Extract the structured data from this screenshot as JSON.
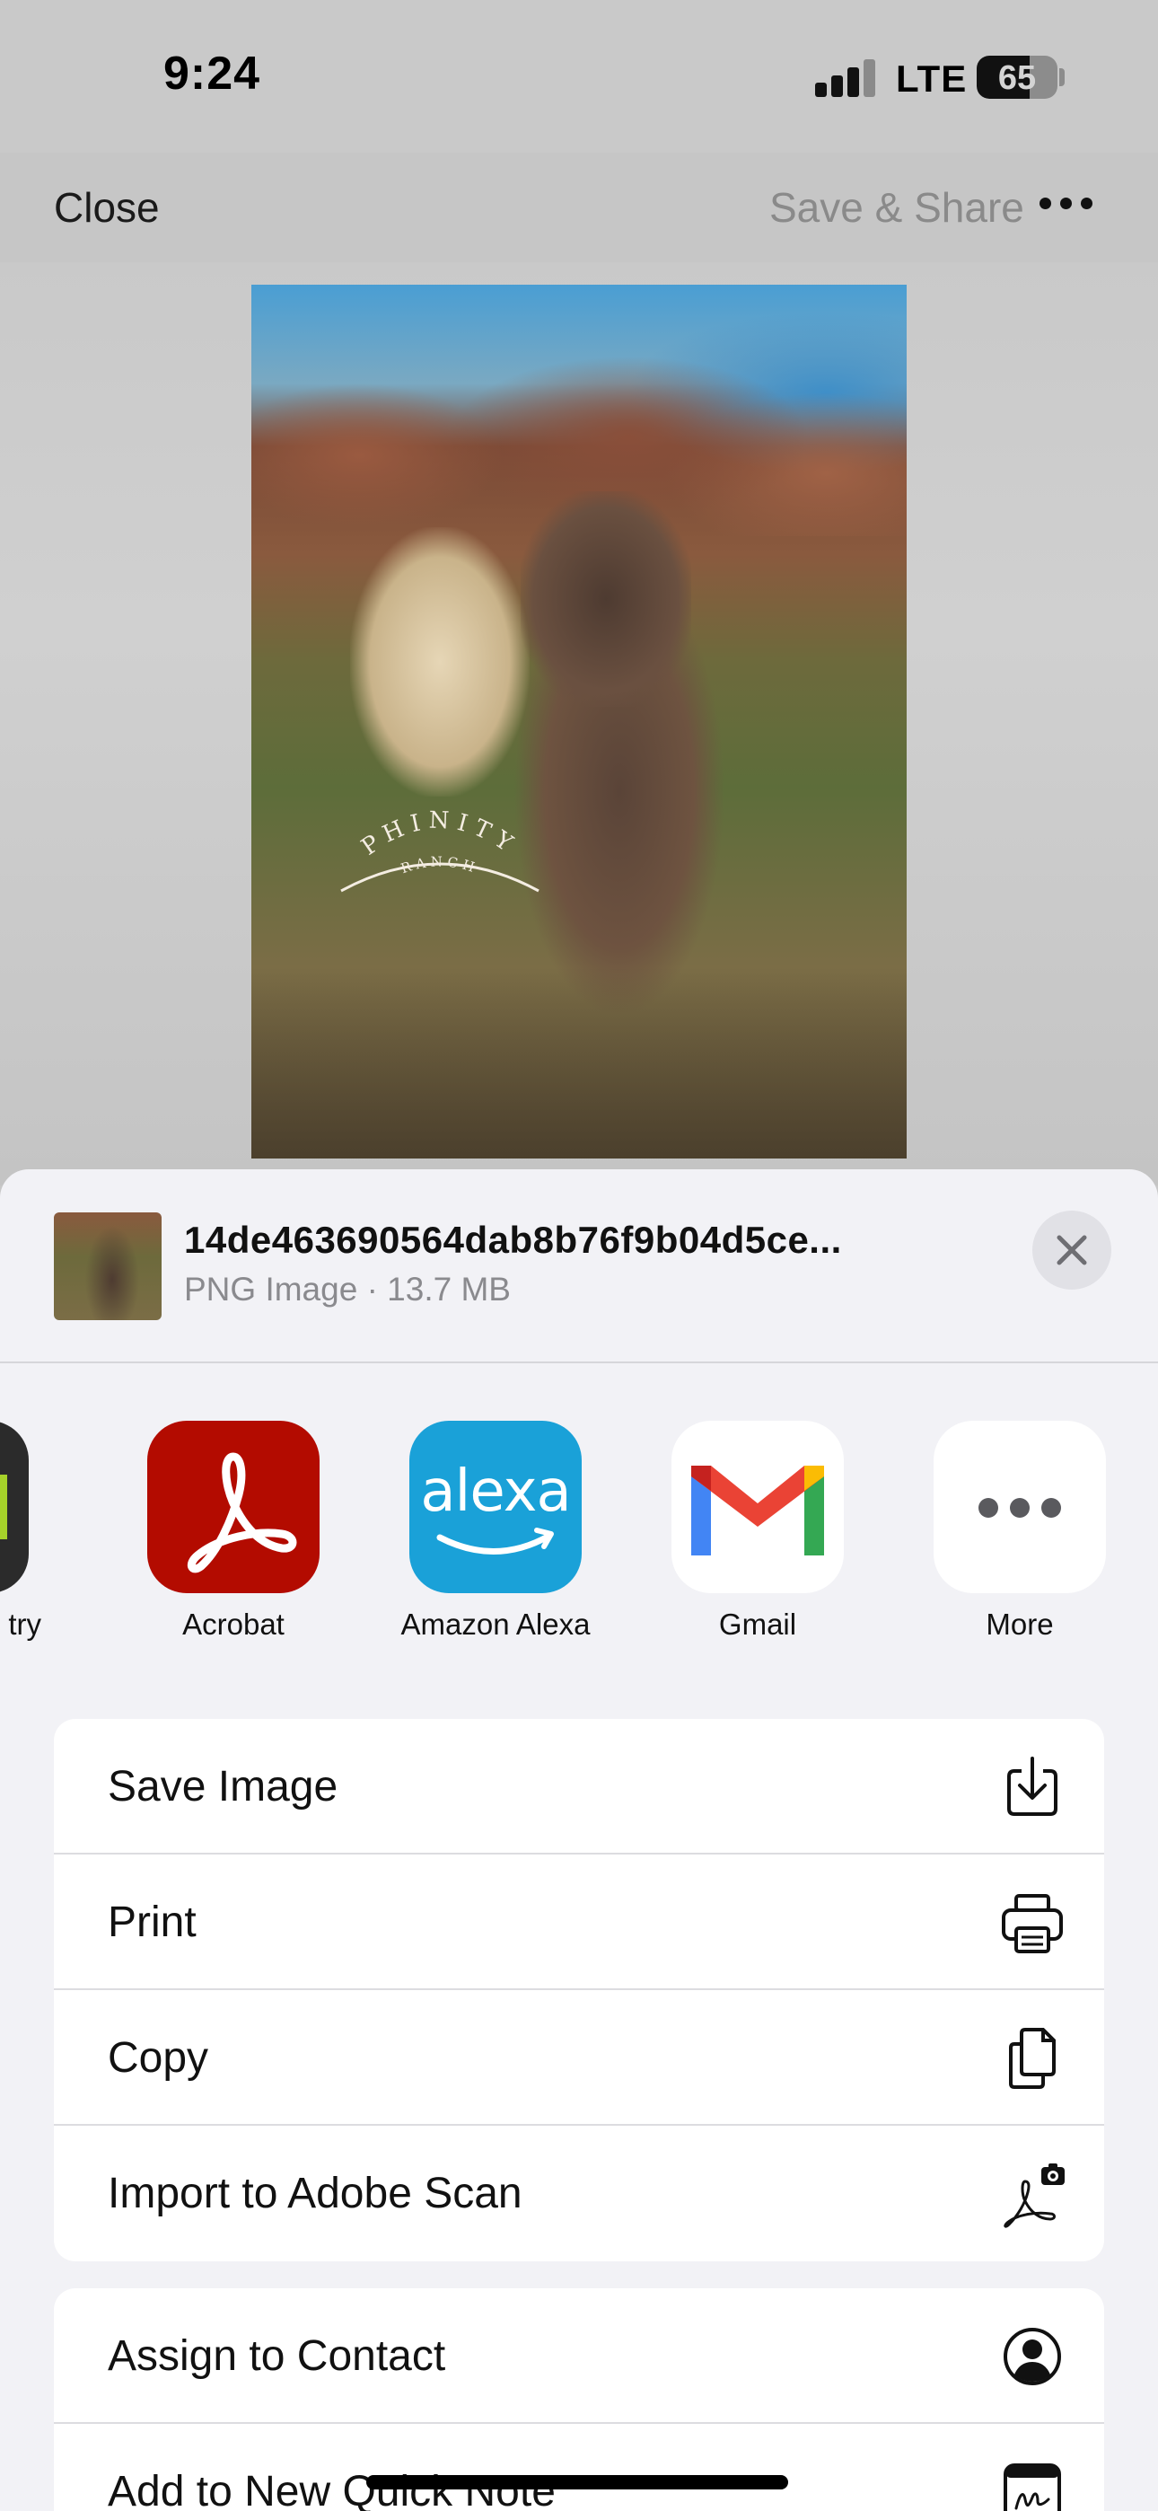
{
  "status_bar": {
    "time": "9:24",
    "network": "LTE",
    "battery_percent": "65",
    "battery_level": 0.65
  },
  "nav": {
    "close_label": "Close",
    "save_share_label": "Save & Share",
    "more_icon": "ellipsis-icon"
  },
  "photo": {
    "watermark_top": "PHINITY",
    "watermark_bottom": "RANCH"
  },
  "share_sheet": {
    "file_name": "14de463690564dab8b76f9b04d5ce...",
    "file_meta": "PNG Image · 13.7 MB",
    "apps": [
      {
        "label": "try",
        "icon": "partial-app-icon"
      },
      {
        "label": "Acrobat",
        "icon": "acrobat-icon",
        "color": "#b30b00"
      },
      {
        "label": "Amazon Alexa",
        "icon": "alexa-icon",
        "color": "#1aa1d8",
        "word": "alexa"
      },
      {
        "label": "Gmail",
        "icon": "gmail-icon"
      },
      {
        "label": "More",
        "icon": "more-icon"
      }
    ],
    "actions_group1": [
      {
        "label": "Save Image",
        "icon": "save-download-icon"
      },
      {
        "label": "Print",
        "icon": "printer-icon"
      },
      {
        "label": "Copy",
        "icon": "copy-documents-icon"
      },
      {
        "label": "Import to Adobe Scan",
        "icon": "adobe-scan-icon"
      }
    ],
    "actions_group2": [
      {
        "label": "Assign to Contact",
        "icon": "contact-person-icon"
      },
      {
        "label": "Add to New Quick Note",
        "icon": "quick-note-icon"
      }
    ]
  }
}
